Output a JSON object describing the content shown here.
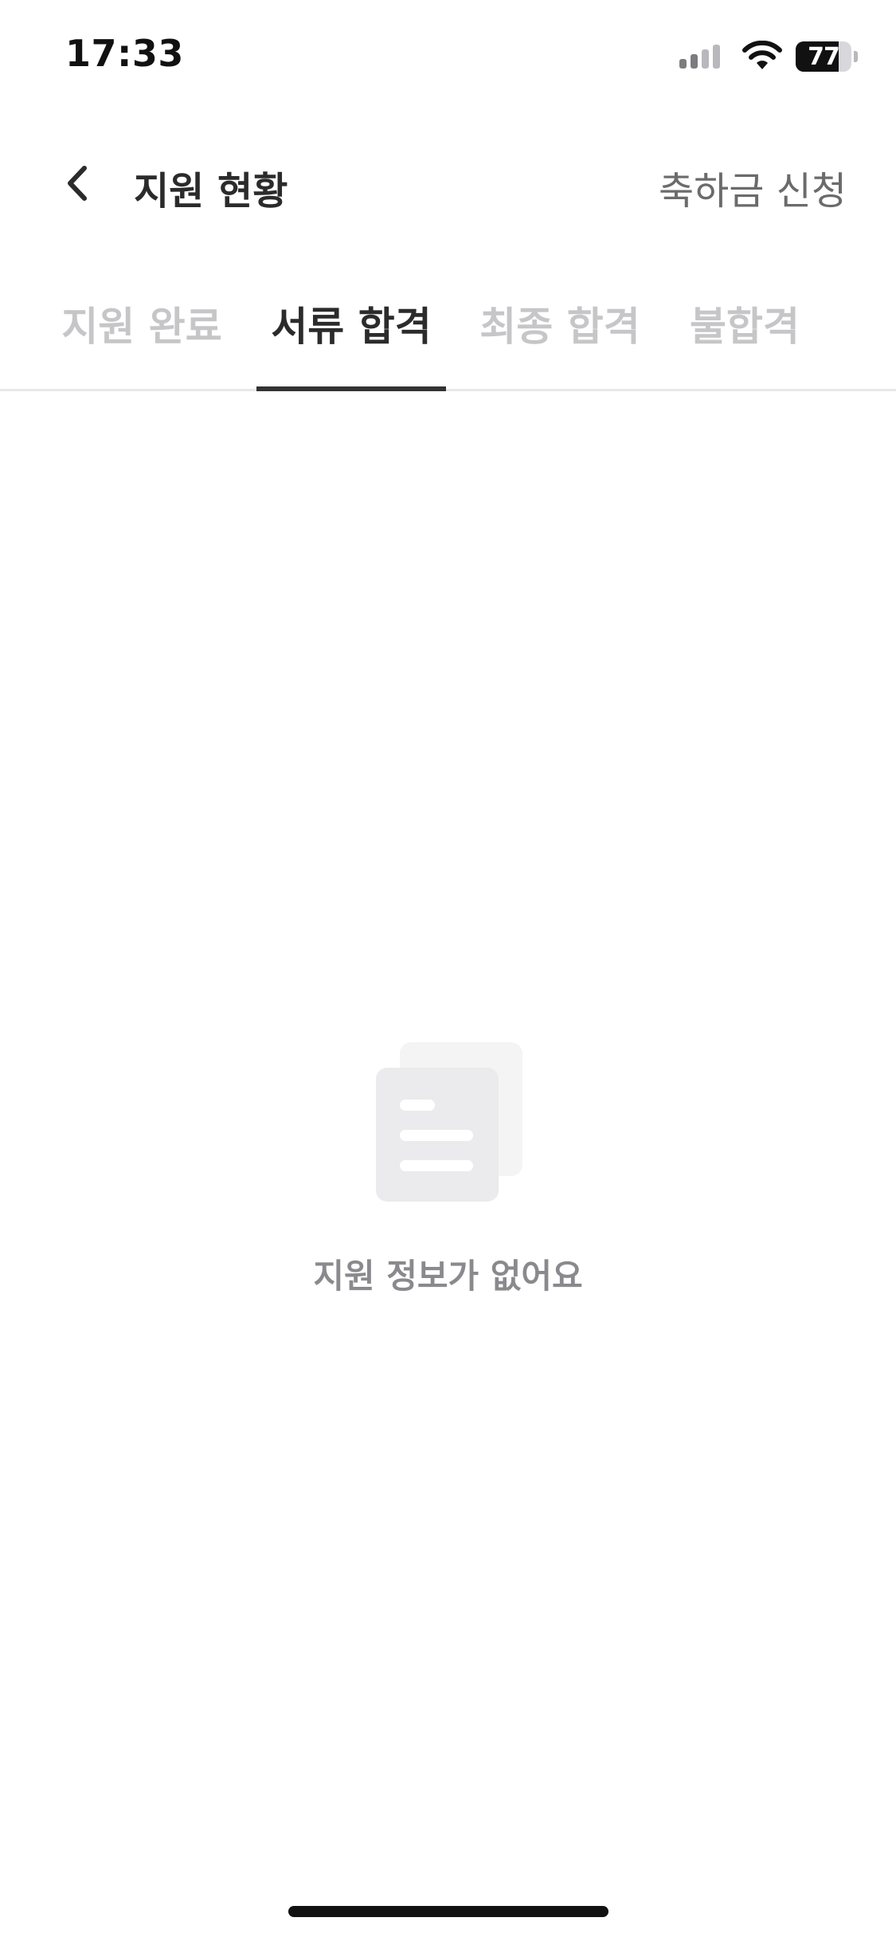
{
  "status_bar": {
    "time": "17:33",
    "battery_level": "77",
    "icons": [
      "signal-icon",
      "wifi-icon",
      "battery-icon"
    ]
  },
  "nav": {
    "back_icon": "chevron-left-icon",
    "title": "지원 현황",
    "action_label": "축하금 신청"
  },
  "tabs": [
    {
      "label": "지원 완료",
      "active": false
    },
    {
      "label": "서류 합격",
      "active": true
    },
    {
      "label": "최종 합격",
      "active": false
    },
    {
      "label": "불합격",
      "active": false
    }
  ],
  "empty_state": {
    "icon": "document-icon",
    "message": "지원 정보가 없어요"
  },
  "colors": {
    "active_text": "#2b2b2b",
    "inactive_tab": "#c6c6c8",
    "secondary_text": "#6b6b6b",
    "empty_text": "#8a8a8e",
    "icon_fill": "#ededee"
  }
}
